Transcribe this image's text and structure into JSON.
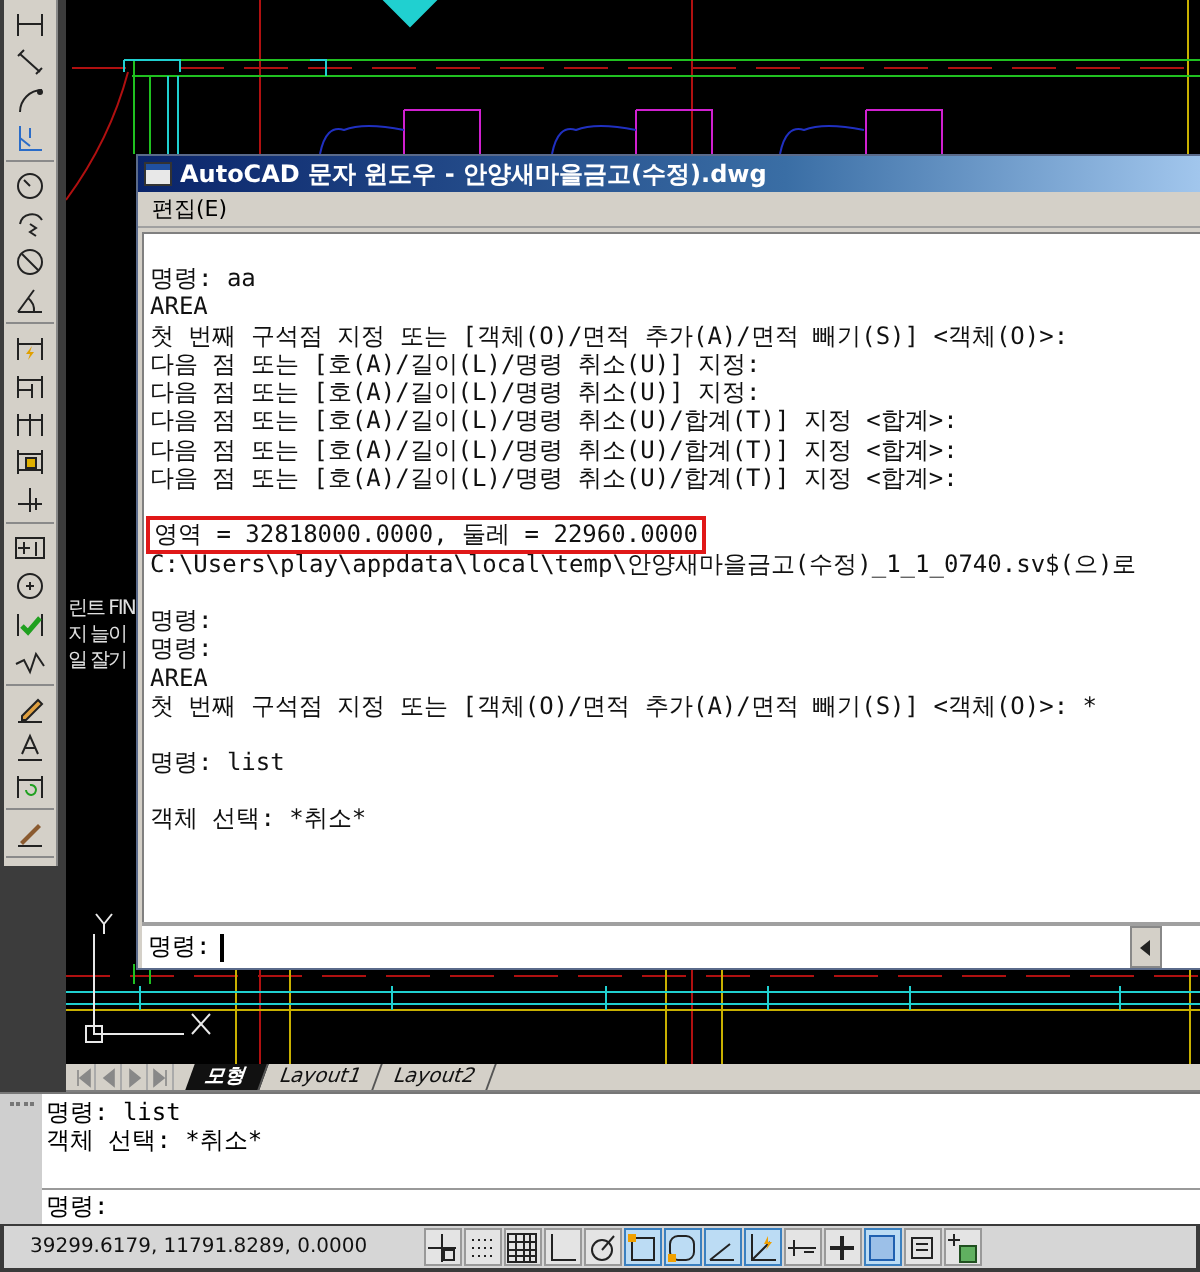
{
  "toolbar": {
    "groups": [
      {
        "tools": [
          {
            "kind": "linear"
          },
          {
            "kind": "aligned"
          },
          {
            "kind": "arclength"
          },
          {
            "kind": "ordinate"
          }
        ]
      },
      {
        "tools": [
          {
            "kind": "radius"
          },
          {
            "kind": "jogged"
          },
          {
            "kind": "diameter"
          },
          {
            "kind": "angular"
          }
        ]
      },
      {
        "tools": [
          {
            "kind": "quick"
          },
          {
            "kind": "baseline"
          },
          {
            "kind": "continue"
          },
          {
            "kind": "space"
          },
          {
            "kind": "break"
          }
        ]
      },
      {
        "tools": [
          {
            "kind": "tolerance"
          },
          {
            "kind": "center"
          },
          {
            "kind": "inspect"
          },
          {
            "kind": "joglinear"
          }
        ]
      },
      {
        "tools": [
          {
            "kind": "edit"
          },
          {
            "kind": "textedit"
          },
          {
            "kind": "update"
          }
        ]
      },
      {
        "tools": [
          {
            "kind": "style"
          }
        ]
      }
    ]
  },
  "drawing": {
    "background_fragments": [
      "린트 FIN",
      "지 늘이",
      "일 잘기"
    ]
  },
  "text_window": {
    "title": "AutoCAD 문자 윈도우 - 안양새마을금고(수정).dwg",
    "menu": [
      "편집(E)"
    ],
    "blocks": [
      {
        "lines": [
          {
            "text": "명령: aa",
            "highlighted": false
          },
          {
            "text": "AREA",
            "highlighted": false
          },
          {
            "text": "첫 번째 구석점 지정 또는 [객체(O)/면적 추가(A)/면적 빼기(S)] <객체(O)>:",
            "highlighted": false
          },
          {
            "text": "다음 점 또는 [호(A)/길이(L)/명령 취소(U)] 지정:",
            "highlighted": false
          },
          {
            "text": "다음 점 또는 [호(A)/길이(L)/명령 취소(U)] 지정:",
            "highlighted": false
          },
          {
            "text": "다음 점 또는 [호(A)/길이(L)/명령 취소(U)/합계(T)] 지정 <합계>:",
            "highlighted": false
          },
          {
            "text": "다음 점 또는 [호(A)/길이(L)/명령 취소(U)/합계(T)] 지정 <합계>:",
            "highlighted": false
          },
          {
            "text": "다음 점 또는 [호(A)/길이(L)/명령 취소(U)/합계(T)] 지정 <합계>:",
            "highlighted": false
          }
        ]
      },
      {
        "lines": [
          {
            "text": "영역 = 32818000.0000, 둘레 = 22960.0000",
            "highlighted": true
          },
          {
            "text": "C:\\Users\\play\\appdata\\local\\temp\\안양새마을금고(수정)_1_1_0740.sv$(으)로",
            "highlighted": false
          }
        ]
      },
      {
        "lines": [
          {
            "text": "명령:",
            "highlighted": false
          },
          {
            "text": "명령:",
            "highlighted": false
          },
          {
            "text": "AREA",
            "highlighted": false
          },
          {
            "text": "첫 번째 구석점 지정 또는 [객체(O)/면적 추가(A)/면적 빼기(S)] <객체(O)>: *",
            "highlighted": false
          }
        ]
      },
      {
        "lines": [
          {
            "text": "명령: list",
            "highlighted": false
          }
        ]
      },
      {
        "lines": [
          {
            "text": "객체 선택: *취소*",
            "highlighted": false
          }
        ]
      }
    ],
    "prompt": "명령:"
  },
  "layout_tabs": {
    "tabs": [
      {
        "label": "모형",
        "selected": true
      },
      {
        "label": "Layout1",
        "selected": false
      },
      {
        "label": "Layout2",
        "selected": false
      }
    ]
  },
  "command_line": {
    "history": [
      "명령: list",
      "객체 선택: *취소*"
    ],
    "prompt": "명령:"
  },
  "status_bar": {
    "coordinates": "39299.6179, 11791.8289, 0.0000",
    "toggles": [
      {
        "kind": "infer",
        "on": false
      },
      {
        "kind": "snap",
        "on": false
      },
      {
        "kind": "grid",
        "on": false
      },
      {
        "kind": "ortho",
        "on": false
      },
      {
        "kind": "polar",
        "on": false
      },
      {
        "kind": "osnap",
        "on": true
      },
      {
        "kind": "osnap3d",
        "on": true
      },
      {
        "kind": "otrack",
        "on": true
      },
      {
        "kind": "ducs",
        "on": true
      },
      {
        "kind": "dyn",
        "on": false
      },
      {
        "kind": "lwt",
        "on": false
      },
      {
        "kind": "tpy",
        "on": true
      },
      {
        "kind": "qp",
        "on": false
      },
      {
        "kind": "sc",
        "on": false
      }
    ]
  }
}
